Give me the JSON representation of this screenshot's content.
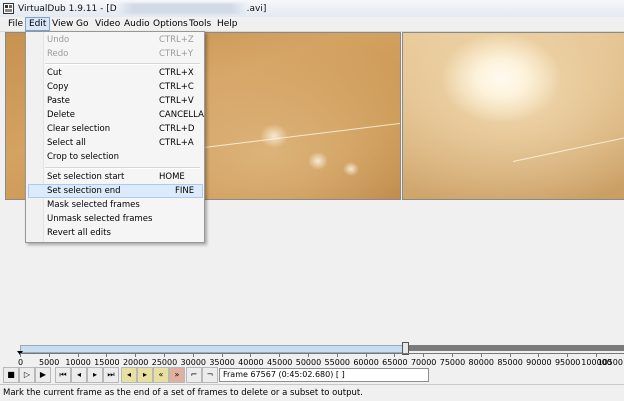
{
  "window": {
    "title_prefix": "VirtualDub 1.9.11 - [D",
    "title_suffix": ".avi]"
  },
  "menubar": [
    "File",
    "Edit",
    "View",
    "Go",
    "Video",
    "Audio",
    "Options",
    "Tools",
    "Help"
  ],
  "edit_menu": {
    "items": [
      {
        "label": "Undo",
        "shortcut": "CTRL+Z",
        "enabled": false
      },
      {
        "label": "Redo",
        "shortcut": "CTRL+Y",
        "enabled": false
      },
      {
        "separator": true
      },
      {
        "label": "Cut",
        "shortcut": "CTRL+X",
        "enabled": true
      },
      {
        "label": "Copy",
        "shortcut": "CTRL+C",
        "enabled": true
      },
      {
        "label": "Paste",
        "shortcut": "CTRL+V",
        "enabled": true
      },
      {
        "label": "Delete",
        "shortcut": "CANCELLA",
        "enabled": true
      },
      {
        "label": "Clear selection",
        "shortcut": "CTRL+D",
        "enabled": true
      },
      {
        "label": "Select all",
        "shortcut": "CTRL+A",
        "enabled": true
      },
      {
        "label": "Crop to selection",
        "shortcut": "",
        "enabled": true
      },
      {
        "separator": true
      },
      {
        "label": "Set selection start",
        "shortcut": "HOME",
        "enabled": true
      },
      {
        "label": "Set selection end",
        "shortcut": "FINE",
        "enabled": true,
        "highlighted": true
      },
      {
        "label": "Mask selected frames",
        "shortcut": "",
        "enabled": true
      },
      {
        "label": "Unmask selected frames",
        "shortcut": "",
        "enabled": true
      },
      {
        "label": "Revert all edits",
        "shortcut": "",
        "enabled": true
      }
    ]
  },
  "timeline": {
    "ticks": [
      "0",
      "5000",
      "10000",
      "15000",
      "20000",
      "25000",
      "30000",
      "35000",
      "40000",
      "45000",
      "50000",
      "55000",
      "60000",
      "65000",
      "70000",
      "75000",
      "80000",
      "85000",
      "90000",
      "95000",
      "100000",
      "10500"
    ],
    "selection_end_fraction": 0.637
  },
  "frame_readout": "Frame 67567 (0:45:02.680) [ ]",
  "status": "Mark the current frame as the end of a set of frames to delete or a subset to output."
}
